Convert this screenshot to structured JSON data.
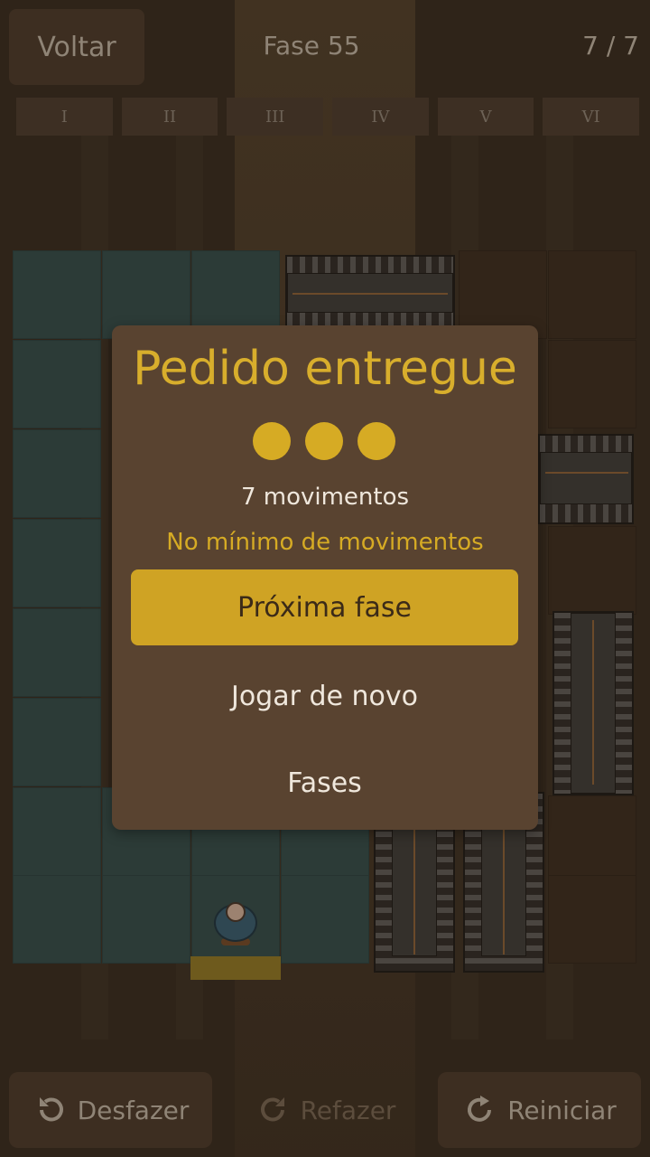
{
  "header": {
    "back_label": "Voltar",
    "level_title": "Fase 55",
    "progress": "7 / 7"
  },
  "chapters": [
    "I",
    "II",
    "III",
    "IV",
    "V",
    "VI"
  ],
  "dialog": {
    "title": "Pedido entregue",
    "stars_earned": 3,
    "stars_total": 3,
    "moves_text": "7 movimentos",
    "min_moves_text": "No mínimo de movimentos",
    "next_label": "Próxima fase",
    "replay_label": "Jogar de novo",
    "levels_label": "Fases"
  },
  "footer": {
    "undo_label": "Desfazer",
    "redo_label": "Refazer",
    "restart_label": "Reiniciar",
    "redo_enabled": false
  },
  "colors": {
    "accent_gold": "#d6ab24",
    "dialog_bg": "#594330",
    "floor": "#2c3b37"
  },
  "icons": {
    "undo": "undo-icon",
    "redo": "redo-icon",
    "restart": "restart-icon"
  }
}
